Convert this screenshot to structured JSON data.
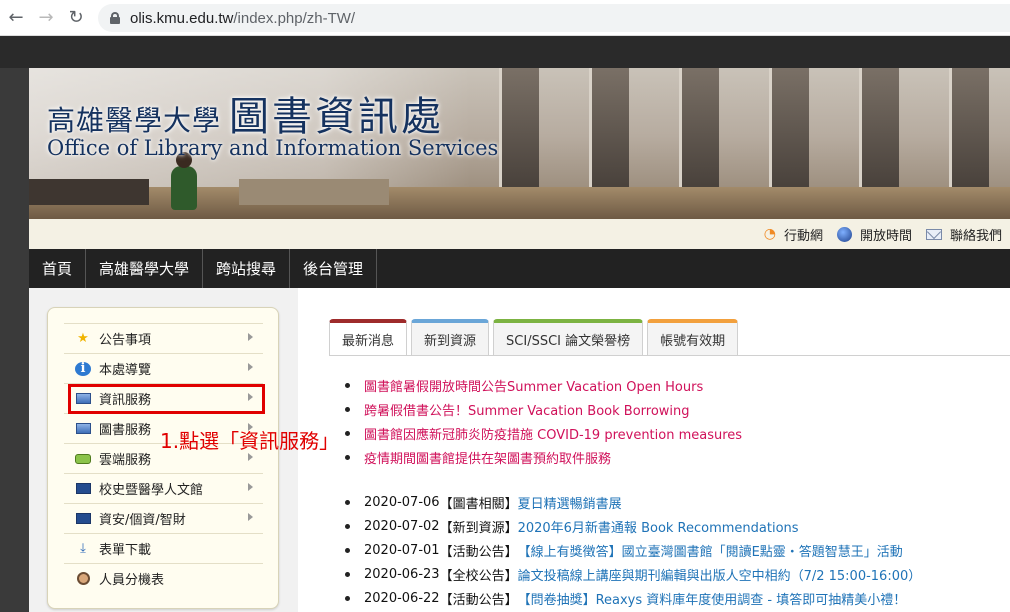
{
  "browser": {
    "url_host": "olis.kmu.edu.tw",
    "url_path": "/index.php/zh-TW/"
  },
  "banner": {
    "title_cn_small": "高雄醫學大學",
    "title_cn_big": "圖書資訊處",
    "title_en": "Office of Library and Information Services"
  },
  "utility": {
    "items": [
      {
        "label": "行動網",
        "icon": "rss-icon"
      },
      {
        "label": "開放時間",
        "icon": "globe-icon"
      },
      {
        "label": "聯絡我們",
        "icon": "mail-icon"
      }
    ]
  },
  "main_nav": {
    "items": [
      "首頁",
      "高雄醫學大學",
      "跨站搜尋",
      "後台管理"
    ]
  },
  "sidebar": {
    "items": [
      {
        "label": "公告事項",
        "icon": "star-icon",
        "has_arrow": true
      },
      {
        "label": "本處導覽",
        "icon": "info-icon",
        "has_arrow": true
      },
      {
        "label": "資訊服務",
        "icon": "window-icon",
        "has_arrow": true
      },
      {
        "label": "圖書服務",
        "icon": "window-icon",
        "has_arrow": true
      },
      {
        "label": "雲端服務",
        "icon": "cloud-icon",
        "has_arrow": true
      },
      {
        "label": "校史暨醫學人文館",
        "icon": "monitor-icon",
        "has_arrow": true
      },
      {
        "label": "資安/個資/智財",
        "icon": "monitor-icon",
        "has_arrow": true
      },
      {
        "label": "表單下載",
        "icon": "download-icon",
        "has_arrow": false
      },
      {
        "label": "人員分機表",
        "icon": "user-icon",
        "has_arrow": false
      }
    ]
  },
  "annotation": {
    "text": "1.點選「資訊服務」",
    "color": "#e00000"
  },
  "tabs": [
    {
      "label": "最新消息",
      "color": "#9e2b2b",
      "active": true
    },
    {
      "label": "新到資源",
      "color": "#6aa6d8",
      "active": false
    },
    {
      "label": "SCI/SSCI 論文榮譽榜",
      "color": "#7cb342",
      "active": false
    },
    {
      "label": "帳號有效期",
      "color": "#f2a03d",
      "active": false
    }
  ],
  "news": [
    "圖書館暑假開放時間公告Summer Vacation Open Hours",
    "跨暑假借書公告！Summer Vacation Book Borrowing",
    "圖書館因應新冠肺炎防疫措施 COVID-19 prevention measures",
    "疫情期間圖書館提供在架圖書預約取件服務"
  ],
  "posts": [
    {
      "date": "2020-07-06",
      "tag": "【圖書相關】",
      "title": "夏日精選暢銷書展"
    },
    {
      "date": "2020-07-02",
      "tag": "【新到資源】",
      "title": "2020年6月新書通報 Book Recommendations"
    },
    {
      "date": "2020-07-01",
      "tag": "【活動公告】",
      "title": "【線上有獎徵答】國立臺灣圖書館「閱讀E點靈・答題智慧王」活動"
    },
    {
      "date": "2020-06-23",
      "tag": "【全校公告】",
      "title": "論文投稿線上講座與期刊編輯與出版人空中相約（7/2 15:00-16:00）"
    },
    {
      "date": "2020-06-22",
      "tag": "【活動公告】",
      "title": "【問卷抽獎】Reaxys 資料庫年度使用調查 - 填答即可抽精美小禮！"
    }
  ]
}
